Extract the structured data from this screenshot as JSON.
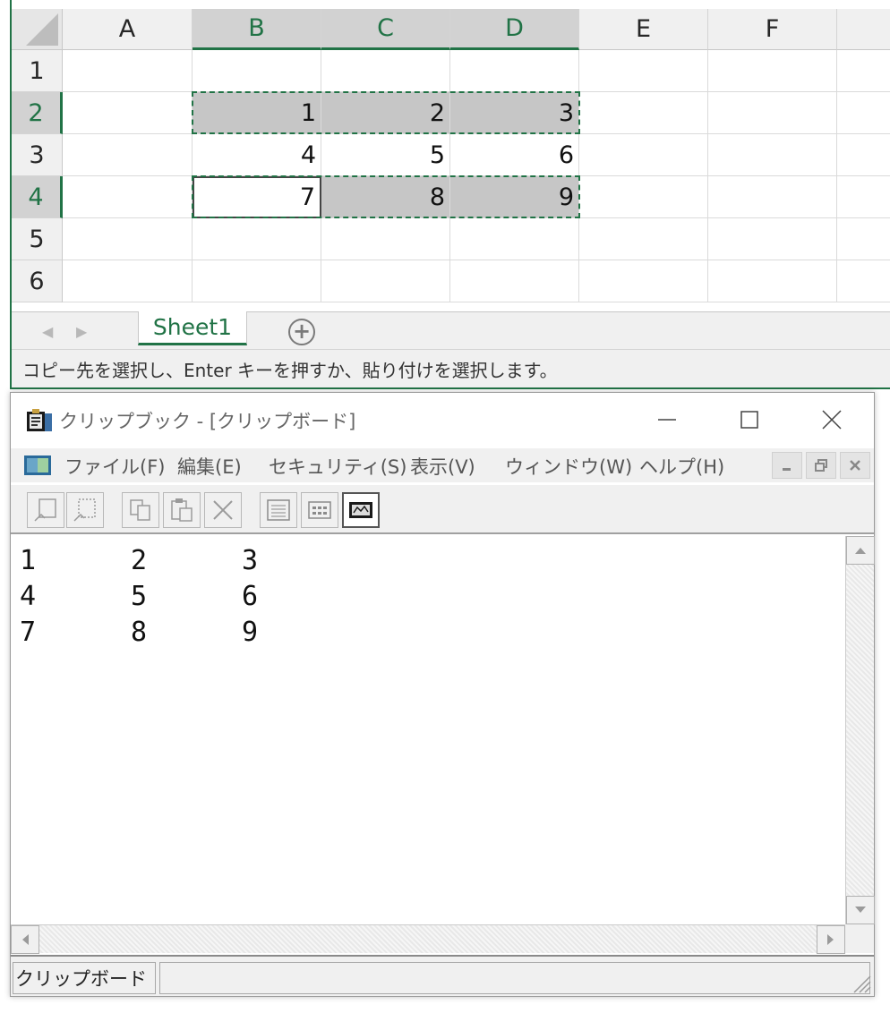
{
  "excel": {
    "columns": [
      "A",
      "B",
      "C",
      "D",
      "E",
      "F"
    ],
    "rows": [
      "1",
      "2",
      "3",
      "4",
      "5",
      "6"
    ],
    "cells": {
      "B2": "1",
      "C2": "2",
      "D2": "3",
      "B3": "4",
      "C3": "5",
      "D3": "6",
      "B4": "7",
      "C4": "8",
      "D4": "9"
    },
    "sheet_tab": "Sheet1",
    "add_sheet_symbol": "+",
    "status": "コピー先を選択し、Enter キーを押すか、貼り付けを選択します。"
  },
  "clipbook": {
    "title": "クリップブック - [クリップボード]",
    "menu": {
      "file": "ファイル(F)",
      "edit": "編集(E)",
      "security": "セキュリティ(S)",
      "view": "表示(V)",
      "window": "ウィンドウ(W)",
      "help": "ヘルプ(H)"
    },
    "content_rows": [
      [
        "1",
        "2",
        "3"
      ],
      [
        "4",
        "5",
        "6"
      ],
      [
        "7",
        "8",
        "9"
      ]
    ],
    "status_left": "クリップボード"
  }
}
